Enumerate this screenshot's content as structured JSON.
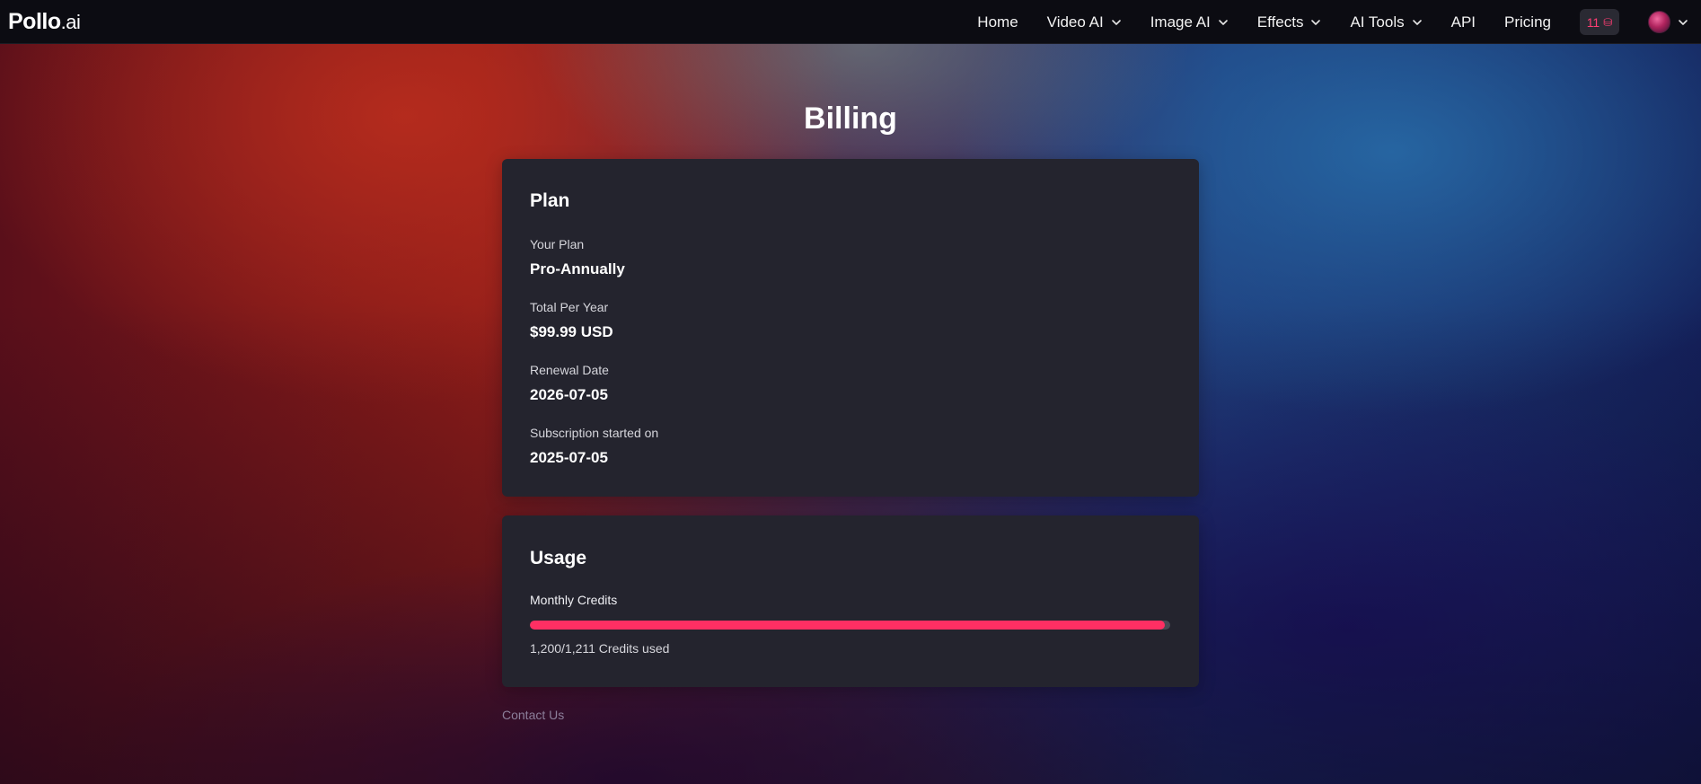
{
  "header": {
    "logo_main": "Pollo",
    "logo_suffix": ".ai",
    "nav": {
      "home": "Home",
      "video_ai": "Video AI",
      "image_ai": "Image AI",
      "effects": "Effects",
      "ai_tools": "AI Tools",
      "api": "API",
      "pricing": "Pricing"
    },
    "credits_count": "11",
    "credits_icon": "coin-stack-icon"
  },
  "page": {
    "title": "Billing"
  },
  "plan": {
    "title": "Plan",
    "your_plan_label": "Your Plan",
    "your_plan_value": "Pro-Annually",
    "total_label": "Total Per Year",
    "total_value": "$99.99 USD",
    "renewal_label": "Renewal Date",
    "renewal_value": "2026-07-05",
    "started_label": "Subscription started on",
    "started_value": "2025-07-05"
  },
  "usage": {
    "title": "Usage",
    "monthly_label": "Monthly Credits",
    "used": 1200,
    "total": 1211,
    "used_text": "1,200/1,211 Credits used"
  },
  "footer": {
    "contact": "Contact Us"
  },
  "colors": {
    "accent": "#ff2f63",
    "card_bg": "#24242e",
    "header_bg": "#0c0c12"
  }
}
